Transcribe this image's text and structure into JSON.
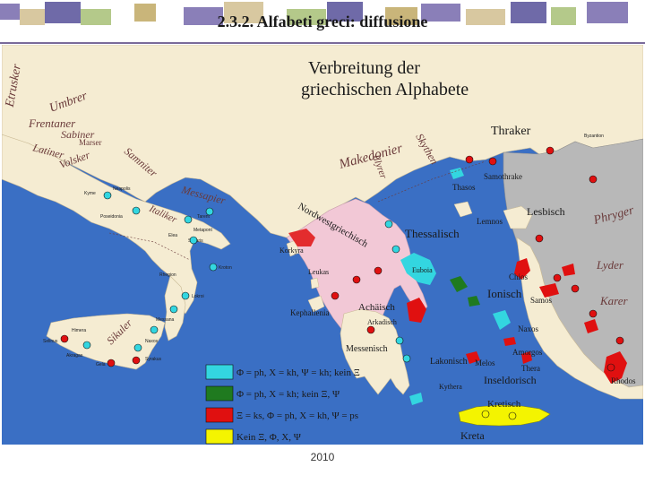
{
  "slide": {
    "title": "2.3.2. Alfabeti greci: diffusione",
    "footer_year": "2010"
  },
  "map": {
    "title_line1": "Verbreitung der",
    "title_line2": "griechischen Alphabete",
    "peoples": {
      "etrusker": "Etrusker",
      "umbrer": "Umbrer",
      "frentaner": "Frentaner",
      "sabiner": "Sabiner",
      "marser": "Marser",
      "latiner": "Latiner",
      "volsker": "Volsker",
      "samniter": "Samniter",
      "messapier": "Messapier",
      "thraker": "Thraker",
      "makedonier": "Makedonier",
      "skythen": "Skythen",
      "illyrer": "Illyrer",
      "phryger": "Phryger",
      "lyder": "Lyder",
      "karer": "Karer",
      "sikuler": "Sikuler",
      "italiker": "Italiker",
      "nordwestgriechisch": "Nordwestgriechisch"
    },
    "regions": {
      "thessalisch": "Thessalisch",
      "lesbisch": "Lesbisch",
      "ionisch": "Ionisch",
      "achaeisch": "Achäisch",
      "messenisch": "Messenisch",
      "lakonisch": "Lakonisch",
      "inseldorisch": "Inseldorisch",
      "kretisch": "Kretisch",
      "kreta": "Kreta",
      "kephallenia": "Kephallenia",
      "leukas": "Leukas",
      "korkyra": "Korkyra",
      "thasos": "Thasos",
      "samothrake": "Samothrake",
      "lemnos": "Lemnos",
      "chios": "Chios",
      "samos": "Samos",
      "naxos": "Naxos",
      "melos": "Melos",
      "thera": "Thera",
      "rhodos": "Rhodos",
      "amorgos": "Amorgos",
      "kythera": "Kythera",
      "euboia": "Euboia",
      "arkadisch": "Arkadisch"
    },
    "cities": {
      "byzantion": "Byzantion",
      "kyme": "Kyme",
      "poseidonia": "Poseidonia",
      "tarent": "Tarent",
      "metapont": "Metapont",
      "kroton": "Kroton",
      "lokroi": "Lokroi",
      "rhegion": "Rhegion",
      "messana": "Messana",
      "naxos_sic": "Naxos",
      "syrakus": "Syrakus",
      "gela": "Gela",
      "akragas": "Akragas",
      "selinus": "Selinus",
      "himera": "Himera",
      "sybaris": "Sybaris",
      "elea": "Elea",
      "neapolis": "Neapolis"
    }
  },
  "legend": [
    {
      "key": "cyan",
      "color": "#33d6e0",
      "text": "Φ = ph, Χ = kh, Ψ = kh; kein Ξ"
    },
    {
      "key": "green",
      "color": "#1f7a1f",
      "text": "Φ = ph, Χ = kh; kein Ξ, Ψ"
    },
    {
      "key": "red",
      "color": "#e01010",
      "text": "Ξ = ks, Φ = ph, Χ = kh, Ψ = ps"
    },
    {
      "key": "yellow",
      "color": "#f4f400",
      "text": "Kein Ξ, Φ, Χ, Ψ"
    }
  ],
  "colors": {
    "sea": "#3a6fc4",
    "land_light": "#f5ecd2",
    "land_pink": "#f2c8d6",
    "land_gray": "#b8b8b8",
    "cyan": "#33d6e0",
    "green": "#1f7a1f",
    "red": "#e01010",
    "yellow": "#f4f400",
    "peoples_label": "#6a3a3a"
  }
}
